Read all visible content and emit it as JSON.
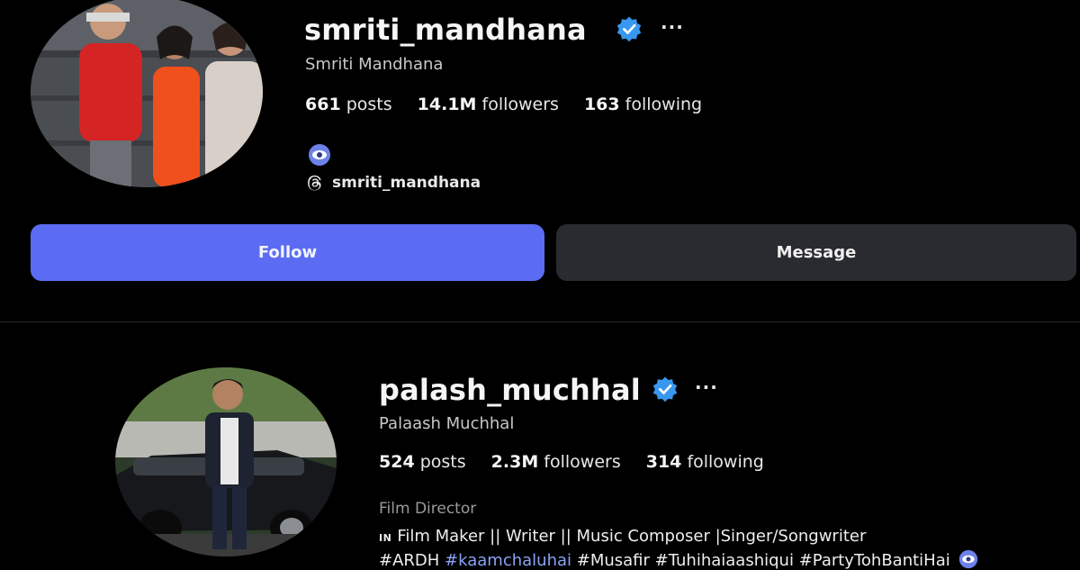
{
  "profiles": [
    {
      "username": "smriti_mandhana",
      "full_name": "Smriti Mandhana",
      "more_label": "···",
      "stats": {
        "posts_count": "661",
        "posts_label": "posts",
        "followers_count": "14.1M",
        "followers_label": "followers",
        "following_count": "163",
        "following_label": "following"
      },
      "bio_icon": "eye-emoji-icon",
      "threads_handle": "smriti_mandhana",
      "buttons": {
        "follow": "Follow",
        "message": "Message"
      }
    },
    {
      "username": "palash_muchhal",
      "full_name": "Palaash Muchhal",
      "more_label": "···",
      "stats": {
        "posts_count": "524",
        "posts_label": "posts",
        "followers_count": "2.3M",
        "followers_label": "followers",
        "following_count": "314",
        "following_label": "following"
      },
      "category": "Film Director",
      "bio": {
        "flag": "IN",
        "line1": "Film Maker || Writer || Music Composer |Singer/Songwriter",
        "hashtags": [
          "#ARDH",
          "#kaamchaluhai",
          "#Musafir",
          "#Tuhihaiaashiqui",
          "#PartyTohBantiHai"
        ],
        "linked_hashtag_index": 1,
        "trailing_icon": "eye-emoji-icon"
      }
    }
  ],
  "colors": {
    "background": "#000000",
    "verified": "#3897f0",
    "follow_button": "#5b6cf2",
    "message_button": "#2a2b30",
    "hashtag_link": "#8aa4f5"
  },
  "icons": {
    "verified": "verified-badge-icon",
    "threads": "threads-icon",
    "more": "more-options-icon"
  }
}
